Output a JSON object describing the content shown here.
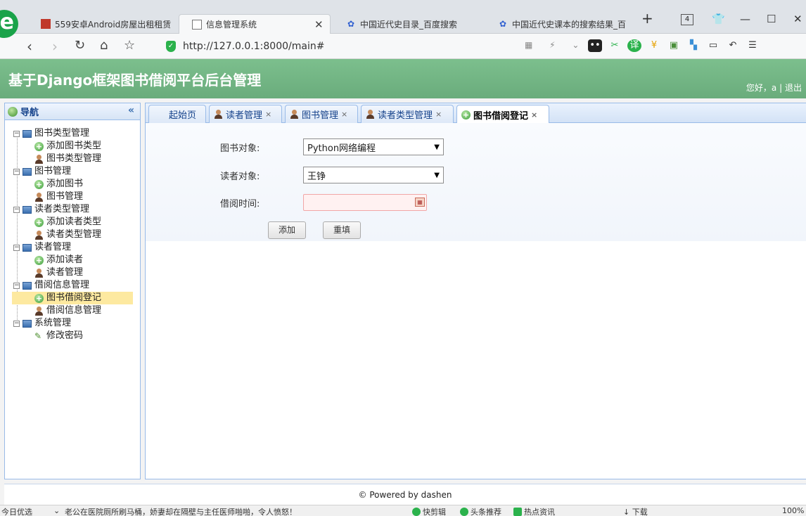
{
  "browser": {
    "tabs": [
      {
        "label": "559安卓Android房屋出租租赁",
        "icon": "red-app-icon"
      },
      {
        "label": "信息管理系统",
        "icon": "page-icon",
        "active": true
      },
      {
        "label": "中国近代史目录_百度搜索",
        "icon": "baidu-paw-icon"
      },
      {
        "label": "中国近代史课本的搜索结果_百",
        "icon": "baidu-paw-icon"
      }
    ],
    "new_tab": "+",
    "tab_count": "4",
    "url": "http://127.0.0.1:8000/main#",
    "window_controls": {
      "minimize": "—",
      "maximize": "☐",
      "close": "✕"
    }
  },
  "app": {
    "title": "基于Django框架图书借阅平台后台管理",
    "greeting": "您好，a",
    "separator": "|",
    "logout": "退出"
  },
  "sidebar": {
    "title": "导航",
    "collapse": "«",
    "groups": [
      {
        "label": "图书类型管理",
        "children": [
          {
            "label": "添加图书类型",
            "icon": "add-icon"
          },
          {
            "label": "图书类型管理",
            "icon": "user-icon"
          }
        ]
      },
      {
        "label": "图书管理",
        "children": [
          {
            "label": "添加图书",
            "icon": "add-icon"
          },
          {
            "label": "图书管理",
            "icon": "user-icon"
          }
        ]
      },
      {
        "label": "读者类型管理",
        "children": [
          {
            "label": "添加读者类型",
            "icon": "add-icon"
          },
          {
            "label": "读者类型管理",
            "icon": "user-icon"
          }
        ]
      },
      {
        "label": "读者管理",
        "children": [
          {
            "label": "添加读者",
            "icon": "add-icon"
          },
          {
            "label": "读者管理",
            "icon": "user-icon"
          }
        ]
      },
      {
        "label": "借阅信息管理",
        "children": [
          {
            "label": "图书借阅登记",
            "icon": "add-icon",
            "selected": true
          },
          {
            "label": "借阅信息管理",
            "icon": "user-icon"
          }
        ]
      },
      {
        "label": "系统管理",
        "children": [
          {
            "label": "修改密码",
            "icon": "pencil-icon"
          }
        ]
      }
    ]
  },
  "content_tabs": [
    {
      "label": "起始页",
      "closable": false
    },
    {
      "label": "读者管理",
      "closable": true,
      "icon": "user-icon"
    },
    {
      "label": "图书管理",
      "closable": true,
      "icon": "user-icon"
    },
    {
      "label": "读者类型管理",
      "closable": true,
      "icon": "user-icon"
    },
    {
      "label": "图书借阅登记",
      "closable": true,
      "icon": "add-icon",
      "active": true
    }
  ],
  "form": {
    "book_label": "图书对象:",
    "book_value": "Python网络编程",
    "reader_label": "读者对象:",
    "reader_value": "王铮",
    "time_label": "借阅时间:",
    "time_value": "",
    "add_button": "添加",
    "reset_button": "重填"
  },
  "footer": {
    "text": "© Powered by dashen"
  },
  "statusbar": {
    "left_label": "今日优选",
    "news": "老公在医院厕所刷马桶，娇妻却在隔壁与主任医师啪啪，令人愤怒！",
    "items": [
      "快剪辑",
      "头条推荐",
      "热点资讯",
      "下载"
    ],
    "zoom": "100%"
  },
  "colors": {
    "header_green": "#6aac7c",
    "tab_border": "#99bbe8",
    "selected_bg": "#fde9a0",
    "date_invalid": "#f1a6a6"
  }
}
